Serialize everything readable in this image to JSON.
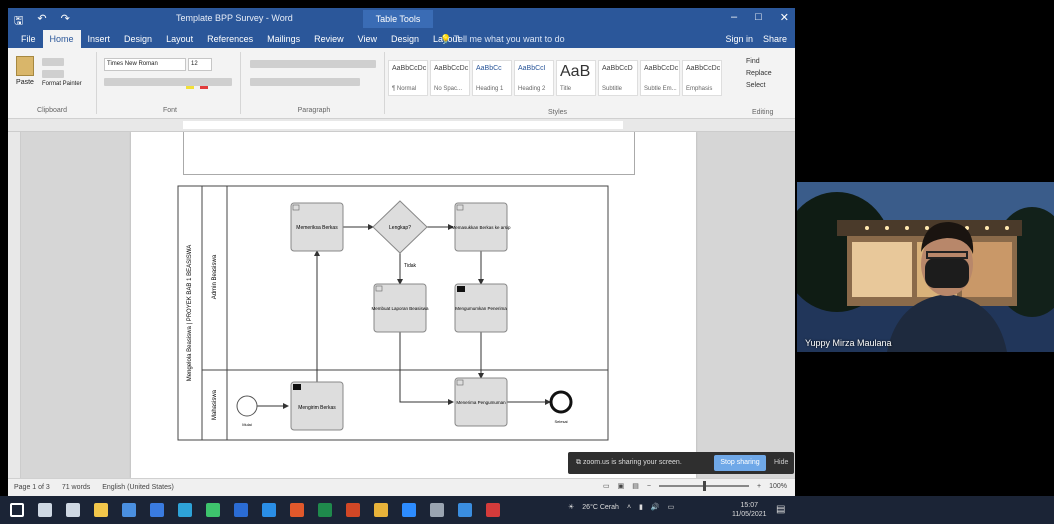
{
  "title_bar": {
    "document_title": "Template BPP Survey - Word",
    "context_tab": "Table Tools",
    "qat_icons": [
      "save-icon",
      "undo-icon",
      "redo-icon"
    ],
    "window_buttons": [
      "–",
      "□",
      "✕"
    ]
  },
  "ribbon_tabs": [
    "File",
    "Home",
    "Insert",
    "Design",
    "Layout",
    "References",
    "Mailings",
    "Review",
    "View",
    "Design",
    "Layout"
  ],
  "active_tab_index": 1,
  "tell_me": "Tell me what you want to do",
  "account": {
    "sign_in": "Sign in",
    "share": "Share"
  },
  "ribbon_groups": {
    "clipboard": "Clipboard",
    "font": "Font",
    "paragraph": "Paragraph",
    "styles": "Styles",
    "editing": "Editing",
    "paste_label": "Paste",
    "format_painter": "Format Painter",
    "font_name": "Times New Roman",
    "font_size": "12"
  },
  "styles": [
    {
      "sample": "AaBbCcDc",
      "name": "¶ Normal"
    },
    {
      "sample": "AaBbCcDc",
      "name": "No Spac..."
    },
    {
      "sample": "AaBbCc",
      "name": "Heading 1"
    },
    {
      "sample": "AaBbCcI",
      "name": "Heading 2"
    },
    {
      "sample": "AaB",
      "name": "Title"
    },
    {
      "sample": "AaBbCcD",
      "name": "Subtitle"
    },
    {
      "sample": "AaBbCcDc",
      "name": "Subtle Em..."
    },
    {
      "sample": "AaBbCcDc",
      "name": "Emphasis"
    }
  ],
  "editing": [
    "Find",
    "Replace",
    "Select"
  ],
  "diagram": {
    "pool_label": "Mengelola Beasiswa | PROYEK BAB 1 BEASISWA",
    "lane_top": "Admin Beasiswa",
    "lane_bottom": "Mahasiswa",
    "tasks": {
      "t1": "Memeriksa Berkas",
      "t2": "Memasukkan Berkas ke arsip",
      "t3": "Membuat Laporan Beasiswa",
      "t4": "Mengumumkan Penerima",
      "t5": "Mengirim Berkas",
      "t6": "Menerima Pengumuman"
    },
    "gateway": "Lengkap?",
    "flow_label": "Tidak",
    "start_label": "Mulai",
    "end_label": "Selesai"
  },
  "status_bar": {
    "page": "Page 1 of 3",
    "words": "71 words",
    "language": "English (United States)",
    "zoom": "100%"
  },
  "share_notice": {
    "message": "zoom.us is sharing your screen.",
    "stop": "Stop sharing",
    "hide": "Hide"
  },
  "taskbar": {
    "weather": "26°C Cerah",
    "time": "15:07",
    "date": "11/05/2021",
    "icons": [
      "start-icon",
      "search-icon",
      "task-view-icon",
      "explorer-icon",
      "store-icon",
      "mail-icon",
      "edge-icon",
      "whatsapp-icon",
      "word-icon",
      "vscode-icon",
      "office-icon",
      "excel-icon",
      "powerpoint-icon",
      "chrome-icon",
      "zoom-icon",
      "settings-icon",
      "photos-icon",
      "app-icon"
    ],
    "icon_colors": [
      "#ffffff",
      "#cfd8e3",
      "#cfd8e3",
      "#f3c74b",
      "#4a8fe0",
      "#3a7be0",
      "#2ea3d8",
      "#3ec46d",
      "#2b6cd4",
      "#2a8ee6",
      "#e0582b",
      "#1f8a4c",
      "#d24726",
      "#e8b33a",
      "#2d8cff",
      "#9aa4b1",
      "#3a8de0",
      "#d43b3b"
    ]
  },
  "webcam": {
    "participant_name": "Yuppy Mirza Maulana"
  },
  "colors": {
    "word_blue": "#2b579a",
    "ribbon": "#f3f3f3",
    "taskbar": "#1b2436",
    "stop_share": "#6fa8e8"
  }
}
